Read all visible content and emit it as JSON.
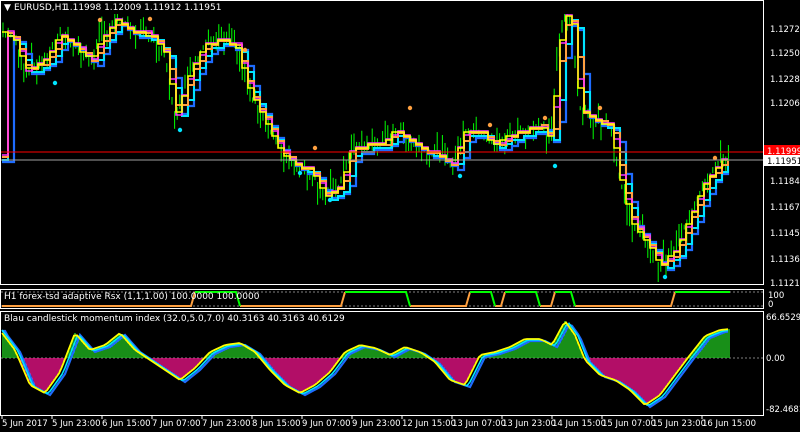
{
  "header": {
    "symbol_label": "EURUSD,H1",
    "ohlc": "1.11998 1.12009 1.11912 1.11951"
  },
  "price_axis": {
    "labels": [
      "1.12725",
      "1.12505",
      "1.12280",
      "1.12060",
      "1.11840",
      "1.11670",
      "1.11455",
      "1.11365",
      "1.11210"
    ],
    "bid_label": "1.11951",
    "ask_label": "1.11999"
  },
  "indicator1": {
    "title": "H1 forex-tsd adaptive Rsx (1,1,1.00) 100.0000 100.0000",
    "scale_labels": [
      "100",
      "0"
    ]
  },
  "indicator2": {
    "title": "Blau candlestick momentum index (32.0,5.0,7.0) 40.3163 40.3163 40.6129",
    "scale_labels": [
      "66.6529",
      "0.00",
      "-82.4681"
    ]
  },
  "time_axis": {
    "labels": [
      "5 Jun 2017",
      "5 Jun 23:00",
      "6 Jun 15:00",
      "7 Jun 07:00",
      "7 Jun 23:00",
      "8 Jun 15:00",
      "9 Jun 07:00",
      "9 Jun 23:00",
      "12 Jun 15:00",
      "13 Jun 07:00",
      "13 Jun 23:00",
      "14 Jun 15:00",
      "15 Jun 07:00",
      "15 Jun 23:00",
      "16 Jun 15:00"
    ]
  },
  "colors": {
    "background": "#000000",
    "candles": "#00ff00",
    "line_yellow": "#ffff00",
    "line_cyan": "#00e5ff",
    "line_blue": "#1e6cff",
    "line_magenta": "#ff33ff",
    "line_orange": "#ffa040",
    "hist_pos": "#22cc22",
    "hist_neg": "#ff1493",
    "ask_line": "#ff0000",
    "bid_line": "#a0a0a0"
  }
}
